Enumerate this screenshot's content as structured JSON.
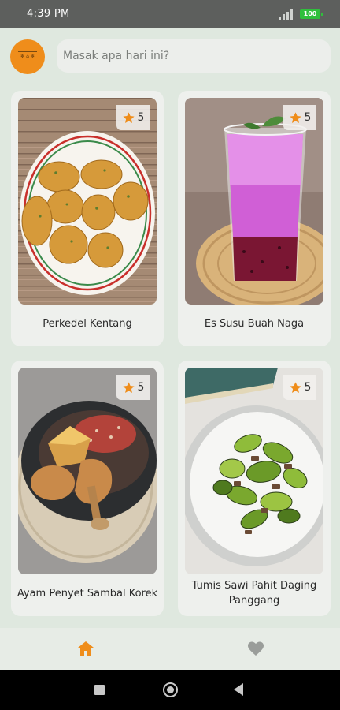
{
  "status_bar": {
    "time": "4:39 PM",
    "battery": "100"
  },
  "header": {
    "search_placeholder": "Masak apa hari ini?",
    "logo_icon": "chef-logo-icon"
  },
  "recipes": [
    {
      "title": "Perkedel Kentang",
      "rating": "5"
    },
    {
      "title": "Es Susu Buah Naga",
      "rating": "5"
    },
    {
      "title": "Ayam Penyet Sambal Korek",
      "rating": "5"
    },
    {
      "title": "Tumis Sawi Pahit Daging Panggang",
      "rating": "5"
    }
  ],
  "bottom_nav": {
    "items": [
      {
        "icon": "home-icon",
        "active": true
      },
      {
        "icon": "heart-icon",
        "active": false
      }
    ]
  },
  "system_nav": {
    "items": [
      "recents-icon",
      "home-circle-icon",
      "back-icon"
    ]
  },
  "colors": {
    "accent": "#ef8d1b",
    "background": "#dfe8df",
    "card": "#eef0ed",
    "star": "#ef8d1b",
    "inactive": "#9a9d9a"
  }
}
